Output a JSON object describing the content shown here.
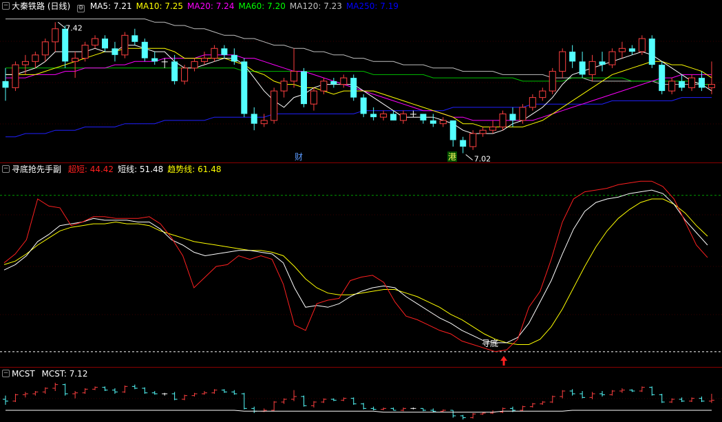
{
  "main_pane": {
    "title": "大秦铁路 (日线)",
    "ma_labels": [
      {
        "text": "MA5: 7.21",
        "color": "#ffffff"
      },
      {
        "text": "MA10: 7.25",
        "color": "#ffff00"
      },
      {
        "text": "MA20: 7.24",
        "color": "#ff00ff"
      },
      {
        "text": "MA60: 7.20",
        "color": "#00ff00"
      },
      {
        "text": "MA120: 7.23",
        "color": "#c0c0c0"
      },
      {
        "text": "MA250: 7.19",
        "color": "#0000ff"
      }
    ],
    "high_marker": "7.42",
    "low_marker": "7.02",
    "badge_cai": "财",
    "badge_gang": "港"
  },
  "indicator_pane": {
    "title": "寻底抢先手副",
    "labels": [
      {
        "text": "超短: 44.42",
        "color": "#ff2020"
      },
      {
        "text": "短线: 51.48",
        "color": "#ffffff"
      },
      {
        "text": "趋势线: 61.48",
        "color": "#ffff00"
      }
    ],
    "annotation": "寻底"
  },
  "mcst_pane": {
    "title": "MCST",
    "label": "MCST: 7.12"
  },
  "colors": {
    "up": "#ff4040",
    "down": "#54ffff",
    "flat": "#ffffff",
    "separator": "#8b0000"
  },
  "chart_data": {
    "type": "candlestick",
    "candles": [
      [
        7.24,
        7.28,
        7.18,
        7.22
      ],
      [
        7.22,
        7.3,
        7.21,
        7.29
      ],
      [
        7.29,
        7.32,
        7.26,
        7.3
      ],
      [
        7.3,
        7.33,
        7.28,
        7.32
      ],
      [
        7.32,
        7.37,
        7.3,
        7.36
      ],
      [
        7.36,
        7.42,
        7.33,
        7.4
      ],
      [
        7.4,
        7.41,
        7.28,
        7.3
      ],
      [
        7.3,
        7.33,
        7.25,
        7.31
      ],
      [
        7.31,
        7.36,
        7.3,
        7.35
      ],
      [
        7.35,
        7.38,
        7.34,
        7.37
      ],
      [
        7.37,
        7.38,
        7.33,
        7.34
      ],
      [
        7.34,
        7.36,
        7.3,
        7.32
      ],
      [
        7.32,
        7.39,
        7.31,
        7.38
      ],
      [
        7.38,
        7.4,
        7.35,
        7.36
      ],
      [
        7.36,
        7.37,
        7.3,
        7.31
      ],
      [
        7.31,
        7.33,
        7.29,
        7.3
      ],
      [
        7.3,
        7.31,
        7.28,
        7.3
      ],
      [
        7.3,
        7.32,
        7.23,
        7.24
      ],
      [
        7.24,
        7.29,
        7.23,
        7.28
      ],
      [
        7.28,
        7.31,
        7.27,
        7.3
      ],
      [
        7.3,
        7.33,
        7.29,
        7.31
      ],
      [
        7.31,
        7.35,
        7.3,
        7.34
      ],
      [
        7.34,
        7.35,
        7.31,
        7.32
      ],
      [
        7.32,
        7.34,
        7.29,
        7.3
      ],
      [
        7.3,
        7.31,
        7.13,
        7.14
      ],
      [
        7.14,
        7.16,
        7.09,
        7.11
      ],
      [
        7.11,
        7.14,
        7.1,
        7.12
      ],
      [
        7.12,
        7.22,
        7.11,
        7.21
      ],
      [
        7.21,
        7.25,
        7.19,
        7.24
      ],
      [
        7.24,
        7.34,
        7.22,
        7.27
      ],
      [
        7.27,
        7.28,
        7.16,
        7.17
      ],
      [
        7.17,
        7.22,
        7.15,
        7.21
      ],
      [
        7.21,
        7.25,
        7.2,
        7.24
      ],
      [
        7.24,
        7.25,
        7.22,
        7.23
      ],
      [
        7.23,
        7.26,
        7.22,
        7.25
      ],
      [
        7.25,
        7.26,
        7.18,
        7.19
      ],
      [
        7.19,
        7.2,
        7.13,
        7.14
      ],
      [
        7.14,
        7.16,
        7.12,
        7.13
      ],
      [
        7.13,
        7.15,
        7.12,
        7.14
      ],
      [
        7.14,
        7.15,
        7.12,
        7.12
      ],
      [
        7.12,
        7.15,
        7.11,
        7.14
      ],
      [
        7.14,
        7.15,
        7.13,
        7.14
      ],
      [
        7.14,
        7.14,
        7.11,
        7.12
      ],
      [
        7.12,
        7.14,
        7.1,
        7.11
      ],
      [
        7.11,
        7.13,
        7.1,
        7.12
      ],
      [
        7.12,
        7.12,
        7.04,
        7.06
      ],
      [
        7.06,
        7.07,
        7.02,
        7.04
      ],
      [
        7.04,
        7.09,
        7.03,
        7.08
      ],
      [
        7.08,
        7.1,
        7.07,
        7.09
      ],
      [
        7.09,
        7.12,
        7.08,
        7.1
      ],
      [
        7.1,
        7.15,
        7.09,
        7.14
      ],
      [
        7.14,
        7.16,
        7.1,
        7.12
      ],
      [
        7.12,
        7.17,
        7.11,
        7.16
      ],
      [
        7.16,
        7.2,
        7.15,
        7.19
      ],
      [
        7.19,
        7.22,
        7.18,
        7.21
      ],
      [
        7.21,
        7.28,
        7.2,
        7.27
      ],
      [
        7.27,
        7.34,
        7.25,
        7.33
      ],
      [
        7.33,
        7.35,
        7.28,
        7.3
      ],
      [
        7.3,
        7.33,
        7.25,
        7.26
      ],
      [
        7.26,
        7.32,
        7.24,
        7.3
      ],
      [
        7.3,
        7.33,
        7.27,
        7.29
      ],
      [
        7.29,
        7.34,
        7.28,
        7.33
      ],
      [
        7.33,
        7.36,
        7.31,
        7.34
      ],
      [
        7.34,
        7.35,
        7.32,
        7.33
      ],
      [
        7.33,
        7.38,
        7.32,
        7.37
      ],
      [
        7.37,
        7.38,
        7.28,
        7.29
      ],
      [
        7.29,
        7.3,
        7.2,
        7.21
      ],
      [
        7.21,
        7.25,
        7.2,
        7.24
      ],
      [
        7.24,
        7.26,
        7.21,
        7.22
      ],
      [
        7.22,
        7.26,
        7.21,
        7.25
      ],
      [
        7.25,
        7.27,
        7.21,
        7.22
      ],
      [
        7.22,
        7.3,
        7.2,
        7.23
      ]
    ],
    "ma5": [
      7.26,
      7.26,
      7.27,
      7.28,
      7.3,
      7.33,
      7.33,
      7.33,
      7.33,
      7.34,
      7.33,
      7.33,
      7.35,
      7.35,
      7.34,
      7.33,
      7.33,
      7.3,
      7.28,
      7.28,
      7.29,
      7.3,
      7.31,
      7.31,
      7.29,
      7.25,
      7.21,
      7.18,
      7.16,
      7.19,
      7.2,
      7.22,
      7.23,
      7.23,
      7.23,
      7.23,
      7.21,
      7.19,
      7.17,
      7.15,
      7.13,
      7.13,
      7.13,
      7.13,
      7.12,
      7.11,
      7.09,
      7.08,
      7.08,
      7.08,
      7.09,
      7.11,
      7.12,
      7.14,
      7.16,
      7.19,
      7.23,
      7.26,
      7.27,
      7.28,
      7.29,
      7.3,
      7.31,
      7.32,
      7.33,
      7.32,
      7.3,
      7.28,
      7.26,
      7.24,
      7.23,
      7.21
    ],
    "ma10": [
      7.26,
      7.26,
      7.26,
      7.26,
      7.27,
      7.28,
      7.29,
      7.3,
      7.31,
      7.32,
      7.33,
      7.33,
      7.34,
      7.34,
      7.34,
      7.34,
      7.34,
      7.33,
      7.31,
      7.31,
      7.31,
      7.31,
      7.31,
      7.3,
      7.29,
      7.27,
      7.26,
      7.24,
      7.23,
      7.23,
      7.22,
      7.22,
      7.21,
      7.2,
      7.21,
      7.21,
      7.21,
      7.21,
      7.2,
      7.19,
      7.18,
      7.17,
      7.16,
      7.15,
      7.14,
      7.13,
      7.11,
      7.11,
      7.1,
      7.1,
      7.1,
      7.1,
      7.1,
      7.11,
      7.12,
      7.14,
      7.16,
      7.18,
      7.2,
      7.22,
      7.24,
      7.26,
      7.27,
      7.28,
      7.29,
      7.3,
      7.3,
      7.29,
      7.29,
      7.28,
      7.27,
      7.25
    ],
    "ma20": [
      7.25,
      7.25,
      7.25,
      7.26,
      7.26,
      7.26,
      7.27,
      7.27,
      7.28,
      7.28,
      7.28,
      7.29,
      7.29,
      7.3,
      7.3,
      7.3,
      7.31,
      7.31,
      7.31,
      7.31,
      7.32,
      7.32,
      7.32,
      7.32,
      7.31,
      7.31,
      7.3,
      7.29,
      7.28,
      7.27,
      7.27,
      7.26,
      7.25,
      7.24,
      7.23,
      7.22,
      7.21,
      7.2,
      7.19,
      7.18,
      7.17,
      7.16,
      7.15,
      7.15,
      7.14,
      7.13,
      7.13,
      7.12,
      7.12,
      7.12,
      7.12,
      7.12,
      7.12,
      7.12,
      7.13,
      7.14,
      7.15,
      7.16,
      7.17,
      7.18,
      7.19,
      7.2,
      7.21,
      7.22,
      7.23,
      7.24,
      7.25,
      7.25,
      7.26,
      7.26,
      7.26,
      7.26
    ],
    "ma60": [
      7.28,
      7.28,
      7.28,
      7.28,
      7.28,
      7.28,
      7.28,
      7.28,
      7.28,
      7.28,
      7.28,
      7.28,
      7.28,
      7.28,
      7.28,
      7.28,
      7.28,
      7.28,
      7.28,
      7.28,
      7.28,
      7.28,
      7.28,
      7.28,
      7.27,
      7.27,
      7.27,
      7.27,
      7.27,
      7.27,
      7.27,
      7.27,
      7.27,
      7.27,
      7.27,
      7.27,
      7.27,
      7.26,
      7.26,
      7.26,
      7.26,
      7.26,
      7.26,
      7.25,
      7.25,
      7.25,
      7.25,
      7.25,
      7.25,
      7.25,
      7.25,
      7.25,
      7.24,
      7.24,
      7.24,
      7.24,
      7.24,
      7.25,
      7.25,
      7.25,
      7.25,
      7.25,
      7.25,
      7.24,
      7.24,
      7.24,
      7.24,
      7.24,
      7.24,
      7.24,
      7.23,
      7.23
    ],
    "ma120": [
      7.43,
      7.43,
      7.43,
      7.43,
      7.43,
      7.43,
      7.43,
      7.43,
      7.43,
      7.43,
      7.43,
      7.43,
      7.43,
      7.43,
      7.43,
      7.42,
      7.42,
      7.41,
      7.41,
      7.4,
      7.4,
      7.39,
      7.38,
      7.38,
      7.37,
      7.37,
      7.36,
      7.35,
      7.35,
      7.34,
      7.34,
      7.33,
      7.33,
      7.32,
      7.32,
      7.31,
      7.31,
      7.3,
      7.3,
      7.3,
      7.29,
      7.29,
      7.29,
      7.28,
      7.28,
      7.28,
      7.27,
      7.27,
      7.27,
      7.27,
      7.26,
      7.26,
      7.26,
      7.26,
      7.26,
      7.25,
      7.25,
      7.25,
      7.25,
      7.24,
      7.24,
      7.24,
      7.24,
      7.24,
      7.24,
      7.24,
      7.23,
      7.23,
      7.23,
      7.23,
      7.23,
      7.23
    ],
    "ma250": [
      7.07,
      7.07,
      7.08,
      7.08,
      7.08,
      7.09,
      7.09,
      7.09,
      7.1,
      7.1,
      7.1,
      7.1,
      7.11,
      7.11,
      7.11,
      7.11,
      7.12,
      7.12,
      7.12,
      7.12,
      7.12,
      7.13,
      7.13,
      7.13,
      7.13,
      7.13,
      7.13,
      7.14,
      7.14,
      7.14,
      7.14,
      7.14,
      7.14,
      7.14,
      7.14,
      7.14,
      7.15,
      7.15,
      7.15,
      7.15,
      7.15,
      7.15,
      7.15,
      7.15,
      7.15,
      7.16,
      7.16,
      7.16,
      7.16,
      7.16,
      7.16,
      7.16,
      7.16,
      7.17,
      7.17,
      7.17,
      7.17,
      7.17,
      7.17,
      7.17,
      7.17,
      7.18,
      7.18,
      7.18,
      7.18,
      7.18,
      7.18,
      7.18,
      7.19,
      7.19,
      7.19,
      7.19
    ],
    "main_ylim": [
      7.0,
      7.45
    ],
    "indicator": {
      "ylim": [
        0,
        100
      ],
      "dashed_top": 90,
      "dashed_bottom": 2,
      "chaoduan": [
        52,
        57,
        65,
        88,
        84,
        83,
        73,
        75,
        78,
        78,
        77,
        77,
        77,
        78,
        74,
        66,
        56,
        38,
        44,
        50,
        51,
        56,
        54,
        56,
        54,
        40,
        17,
        14,
        29,
        31,
        32,
        42,
        44,
        45,
        41,
        30,
        22,
        20,
        17,
        14,
        12,
        8,
        6,
        4,
        2,
        3,
        9,
        27,
        36,
        54,
        75,
        88,
        92,
        93,
        94,
        96,
        97,
        98,
        98,
        95,
        88,
        75,
        62,
        55
      ],
      "duanxian": [
        48,
        51,
        56,
        64,
        68,
        73,
        74,
        75,
        77,
        76,
        76,
        76,
        75,
        75,
        71,
        65,
        62,
        58,
        56,
        57,
        58,
        59,
        59,
        58,
        57,
        52,
        38,
        27,
        28,
        27,
        29,
        33,
        36,
        38,
        39,
        38,
        33,
        29,
        25,
        21,
        18,
        14,
        11,
        8,
        7,
        7,
        10,
        18,
        30,
        42,
        57,
        71,
        81,
        86,
        88,
        89,
        91,
        92,
        93,
        91,
        85,
        76,
        69,
        62
      ],
      "qushi": [
        51,
        53,
        57,
        62,
        66,
        70,
        72,
        73,
        74,
        74,
        75,
        74,
        74,
        73,
        70,
        68,
        66,
        64,
        63,
        62,
        61,
        60,
        59,
        59,
        58,
        56,
        50,
        43,
        38,
        35,
        34,
        34,
        35,
        36,
        37,
        37,
        35,
        33,
        30,
        27,
        23,
        20,
        16,
        12,
        9,
        7,
        6,
        6,
        9,
        16,
        26,
        38,
        50,
        61,
        70,
        77,
        82,
        86,
        88,
        88,
        85,
        80,
        73,
        67
      ]
    },
    "mcst": {
      "line": [
        7.12,
        7.12,
        7.12,
        7.12,
        7.12,
        7.12,
        7.12,
        7.12,
        7.12,
        7.12,
        7.12,
        7.12,
        7.12,
        7.12,
        7.12,
        7.12,
        7.12,
        7.12,
        7.12,
        7.12,
        7.12,
        7.12,
        7.12,
        7.12,
        7.11,
        7.11,
        7.11,
        7.11,
        7.11,
        7.11,
        7.11,
        7.11,
        7.11,
        7.11,
        7.11,
        7.11,
        7.11,
        7.11,
        7.1,
        7.1,
        7.1,
        7.1,
        7.1,
        7.1,
        7.1,
        7.1,
        7.1,
        7.1,
        7.1,
        7.1,
        7.11,
        7.11,
        7.11,
        7.11,
        7.11,
        7.11,
        7.11,
        7.12,
        7.12,
        7.12,
        7.12,
        7.12,
        7.12,
        7.12,
        7.12,
        7.12,
        7.12,
        7.12,
        7.12,
        7.12,
        7.12,
        7.12
      ]
    }
  }
}
